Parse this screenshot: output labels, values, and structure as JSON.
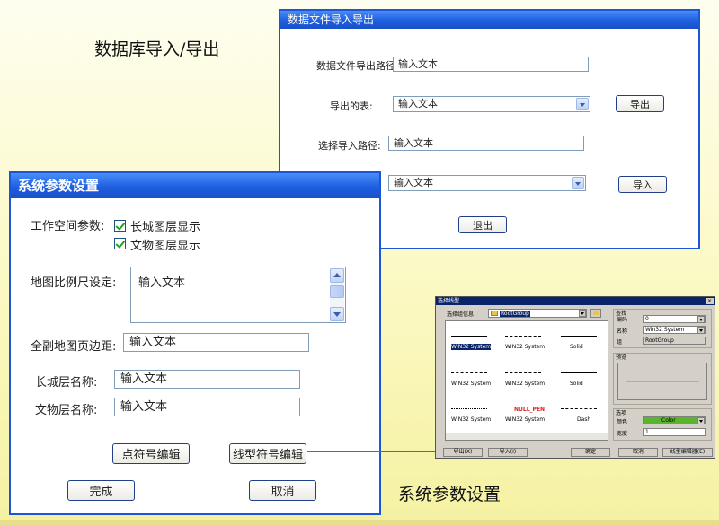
{
  "slide": {
    "title_top": "数据库导入/导出",
    "title_bottom": "系统参数设置"
  },
  "import_export": {
    "title": "数据文件导入导出",
    "export_path_label": "数据文件导出路径:",
    "export_path_value": "输入文本",
    "export_table_label": "导出的表:",
    "export_table_value": "输入文本",
    "export_button": "导出",
    "import_path_label": "选择导入路径:",
    "import_path_value": "输入文本",
    "import_table_value": "输入文本",
    "import_button": "导入",
    "exit_button": "退出"
  },
  "system_params": {
    "title": "系统参数设置",
    "workspace_label": "工作空间参数:",
    "checkbox_city": "长城图层显示",
    "checkbox_relic": "文物图层显示",
    "scale_label": "地图比例尺设定:",
    "scale_value": "输入文本",
    "margin_label": "全副地图页边距:",
    "margin_value": "输入文本",
    "city_layer_label": "长城层名称:",
    "city_layer_value": "输入文本",
    "relic_layer_label": "文物层名称:",
    "relic_layer_value": "输入文本",
    "point_symbol_button": "点符号编辑",
    "line_symbol_button": "线型符号编辑",
    "ok_button": "完成",
    "cancel_button": "取消"
  },
  "style_picker": {
    "title": "选择线型",
    "group_label": "选择组信息",
    "group_value": "RootGroup",
    "cells": [
      {
        "line": "solid",
        "label": "WIN32 System",
        "selected": true
      },
      {
        "line": "dashdot",
        "label": "WIN32 System",
        "selected": false
      },
      {
        "line": "solid",
        "label": "Solid",
        "selected": false
      },
      {
        "line": "dashed",
        "label": "WIN32 System",
        "selected": false
      },
      {
        "line": "dashdot",
        "label": "WIN32 System",
        "selected": false
      },
      {
        "line": "solid",
        "label": "Solid",
        "selected": false
      },
      {
        "line": "dotted",
        "label": "WIN32 System",
        "selected": false
      },
      {
        "line": "null",
        "label": "WIN32 System",
        "null_text": "NULL_PEN",
        "selected": false
      },
      {
        "line": "dashed",
        "label": "Dash",
        "selected": false
      }
    ],
    "search_group": "查找",
    "code_label": "编码",
    "code_value": "0",
    "name_label": "名称",
    "name_value": "Win32 System",
    "group_field_label": "组",
    "group_field_value": "RootGroup",
    "preview_label": "预览",
    "options_label": "选项",
    "color_label": "颜色",
    "color_value": "Color",
    "width_label": "宽度",
    "width_value": "1",
    "btn_export": "导出(X)",
    "btn_import": "导入(I)",
    "btn_ok": "确定",
    "btn_cancel": "取消",
    "btn_editor": "线型编辑器(E)",
    "colors": {
      "color_swatch": "#5ab52e",
      "preview_line": "#a8c06a",
      "selection": "#0a246a"
    }
  }
}
